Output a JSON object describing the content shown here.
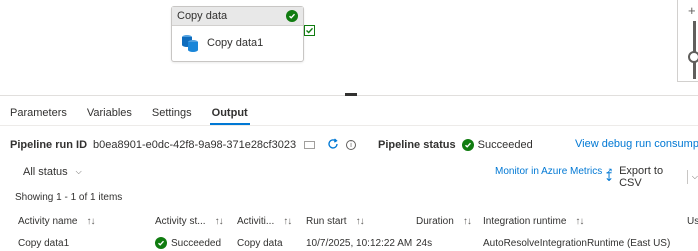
{
  "canvas": {
    "activity_header": "Copy data",
    "activity_name": "Copy data1",
    "zoom_plus": "+",
    "colors": {
      "success": "#107c10",
      "accent": "#0078d4"
    }
  },
  "tabs": [
    "Parameters",
    "Variables",
    "Settings",
    "Output"
  ],
  "active_tab": "Output",
  "run": {
    "id_label": "Pipeline run ID",
    "id_value": "b0ea8901-e0dc-42f8-9a98-371e28cf3023",
    "status_label": "Pipeline status",
    "status_value": "Succeeded",
    "debug_link": "View debug run consumption"
  },
  "filter": {
    "label": "All status"
  },
  "monitor_link": "Monitor in Azure Metrics",
  "export_label": "Export to CSV",
  "showing": "Showing 1 - 1 of 1 items",
  "table": {
    "headers": [
      "Activity name",
      "Activity st...",
      "Activiti...",
      "Run start",
      "Duration",
      "Integration runtime",
      "Us"
    ],
    "rows": [
      [
        "Copy data1",
        "Succeeded",
        "Copy data",
        "10/7/2025, 10:12:22 AM",
        "24s",
        "AutoResolveIntegrationRuntime (East US)",
        ""
      ]
    ]
  },
  "icons": [
    "success-check-icon",
    "copy-data-icon",
    "zoom-plus-icon",
    "copy-icon",
    "refresh-icon",
    "info-icon",
    "chevron-down-icon",
    "external-link-icon",
    "download-icon",
    "sort-icon"
  ]
}
